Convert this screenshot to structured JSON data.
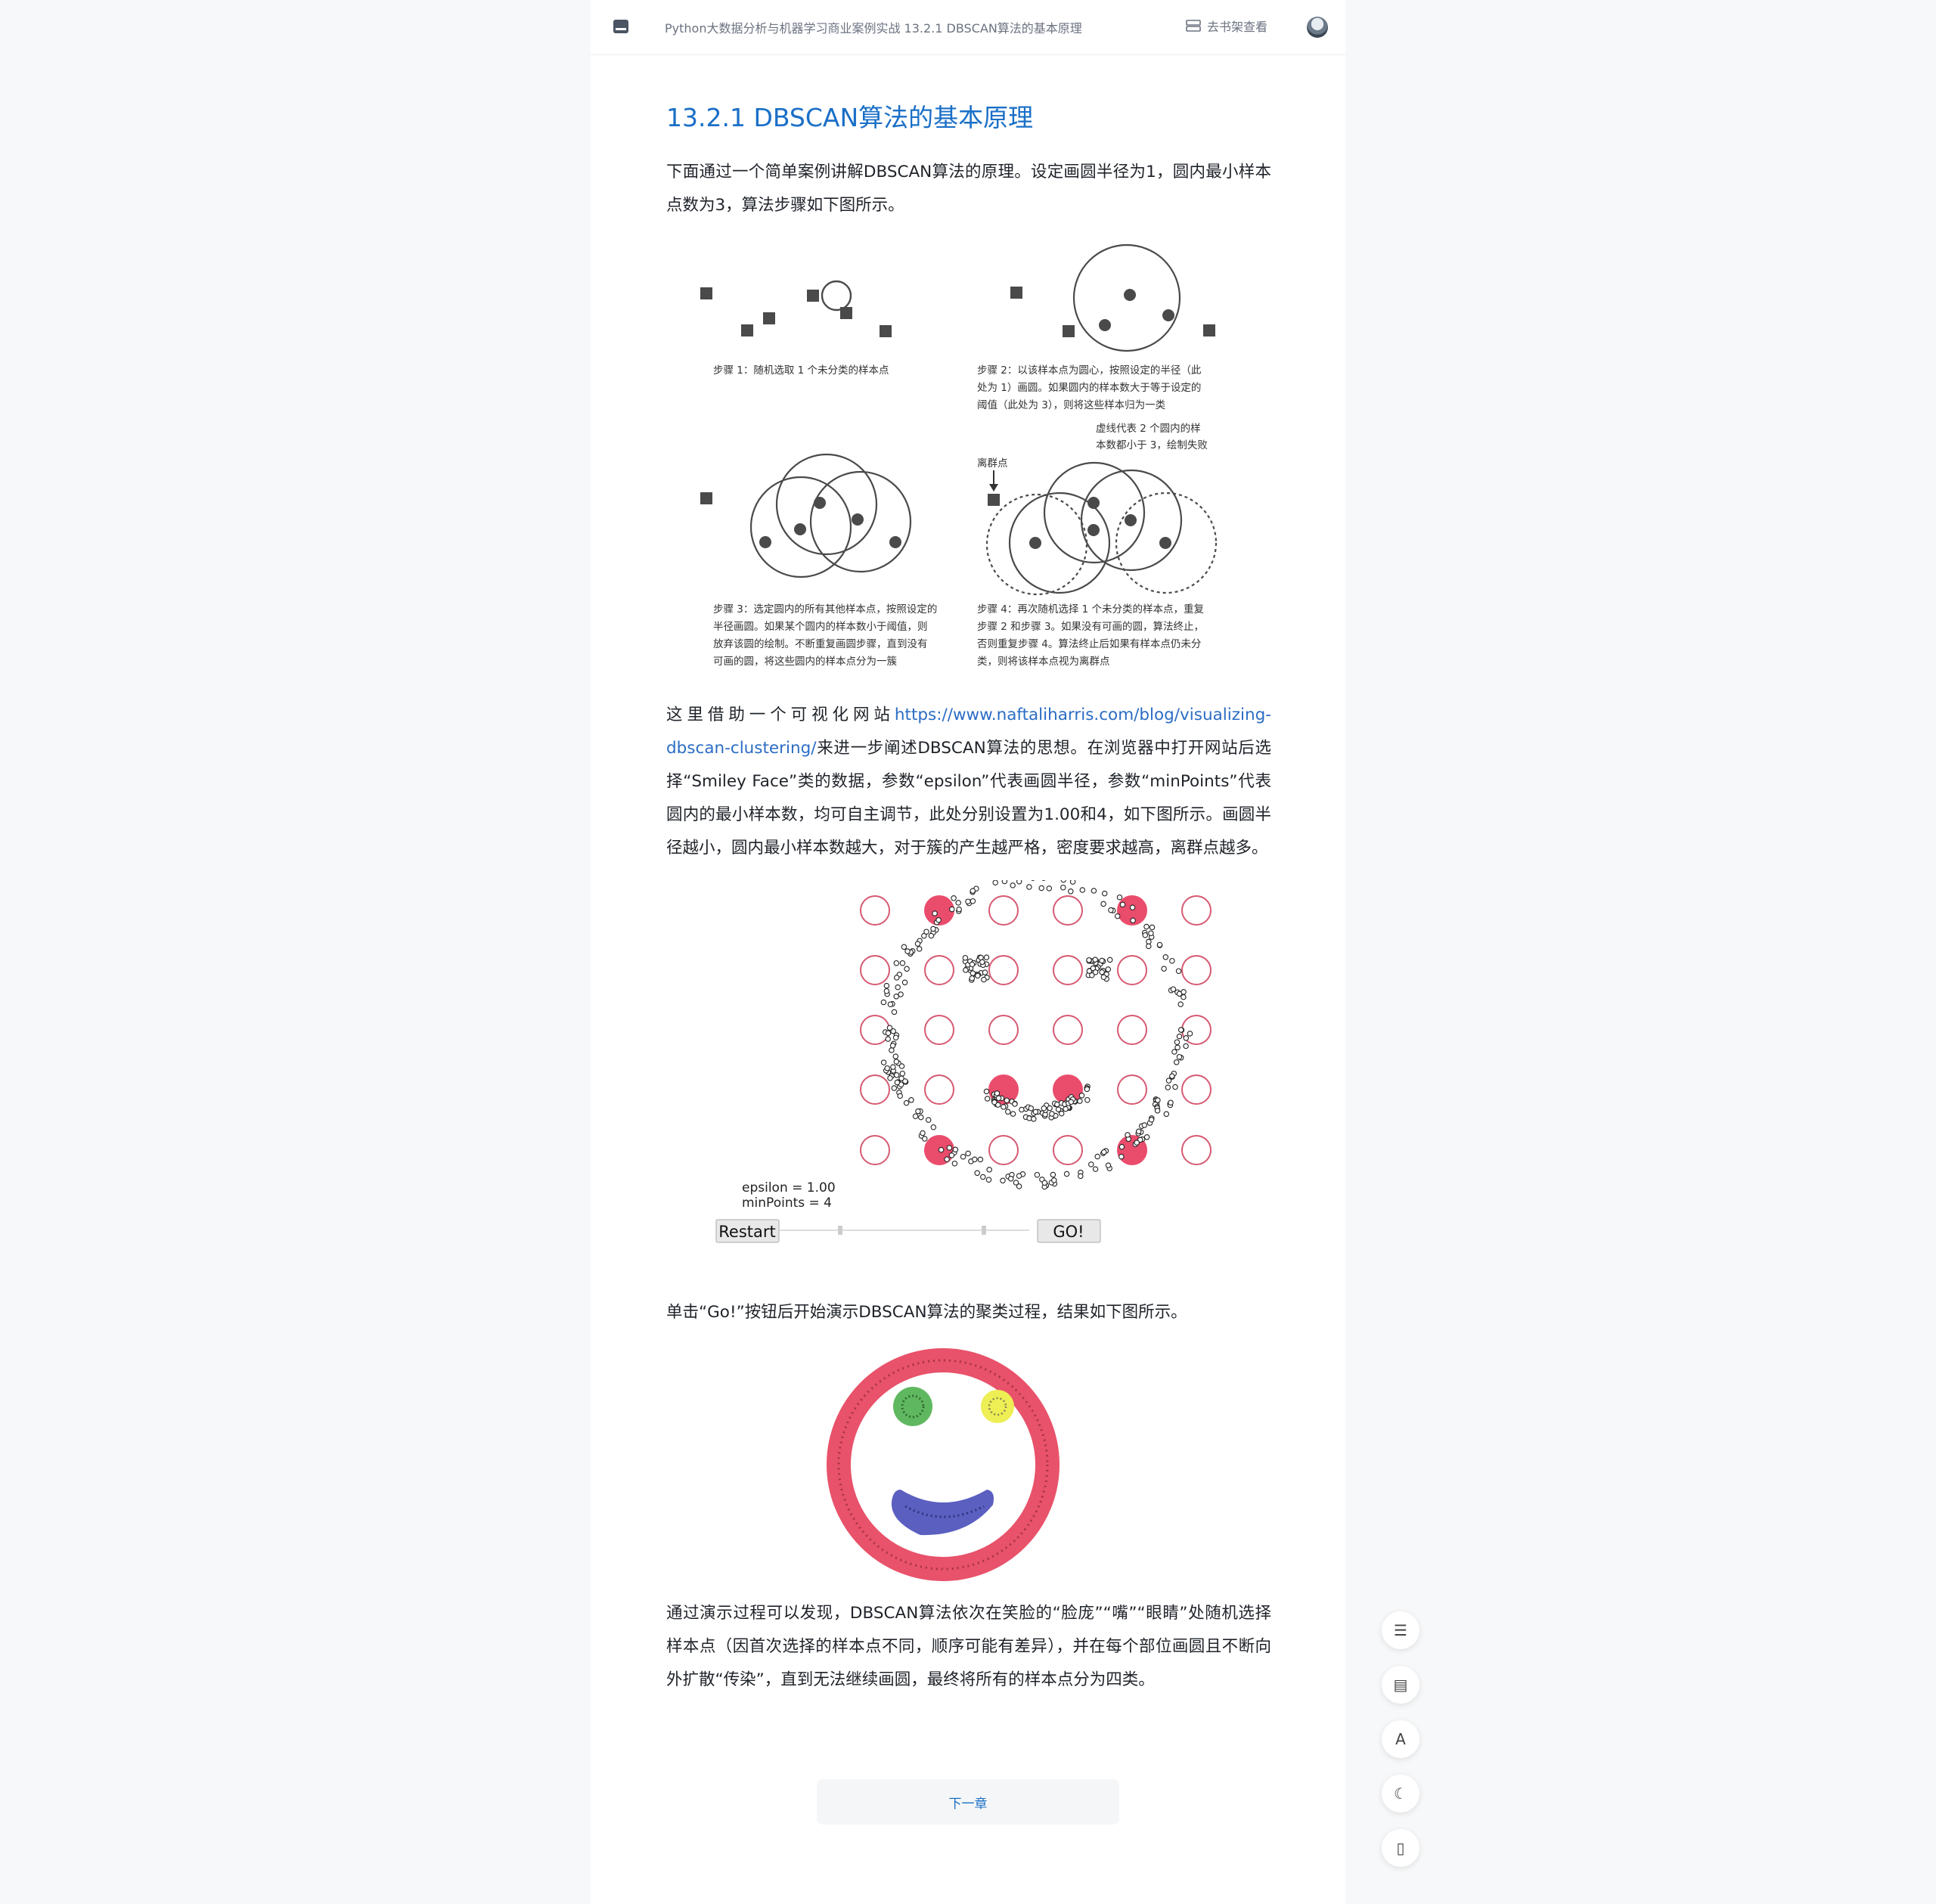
{
  "header": {
    "book_title": "Python大数据分析与机器学习商业案例实战 13.2.1 DBSCAN算法的基本原理",
    "shelf_label": "去书架查看"
  },
  "article": {
    "heading": "13.2.1 DBSCAN算法的基本原理",
    "para1": "下面通过一个简单案例讲解DBSCAN算法的原理。设定画圆半径为1，圆内最小样本点数为3，算法步骤如下图所示。",
    "para2_prefix": "这里借助一个可视化网站",
    "para2_link": "https://www.naftaliharris.com/blog/visualizing-dbscan-clustering/",
    "para2_suffix": "来进一步阐述DBSCAN算法的思想。在浏览器中打开网站后选择“Smiley Face”类的数据，参数“epsilon”代表画圆半径，参数“minPoints”代表圆内的最小样本数，均可自主调节，此处分别设置为1.00和4，如下图所示。画圆半径越小，圆内最小样本数越大，对于簇的产生越严格，密度要求越高，离群点越多。",
    "para3": "单击“Go!”按钮后开始演示DBSCAN算法的聚类过程，结果如下图所示。",
    "para4": "通过演示过程可以发现，DBSCAN算法依次在笑脸的“脸庞”“嘴”“眼睛”处随机选择样本点（因首次选择的样本点不同，顺序可能有差异），并在每个部位画圆且不断向外扩散“传染”，直到无法继续画圆，最终将所有的样本点分为四类。"
  },
  "steps_figure": {
    "step1": "步骤 1：随机选取 1 个未分类的样本点",
    "step2_lines": [
      "步骤 2：以该样本点为圆心，按照设定的半径（此",
      "处为 1）画圆。如果圆内的样本数大于等于设定的",
      "阈值（此处为 3），则将这些样本归为一类"
    ],
    "step3_lines": [
      "步骤 3：选定圆内的所有其他样本点，按照设定的",
      "半径画圆。如果某个圆内的样本数小于阈值，则",
      "放弃该圆的绘制。不断重复画圆步骤，直到没有",
      "可画的圆，将这些圆内的样本点分为一簇"
    ],
    "step4_lines": [
      "步骤 4：再次随机选择 1 个未分类的样本点，重复",
      "步骤 2 和步骤 3。如果没有可画的圆，算法终止，",
      "否则重复步骤 4。算法终止后如果有样本点仍未分",
      "类，则将该样本点视为离群点"
    ],
    "dashed_note_lines": [
      "虚线代表 2 个圆内的样",
      "本数都小于 3，绘制失败"
    ],
    "outlier_label": "离群点"
  },
  "smiley_demo": {
    "epsilon_label": "epsilon = 1.00",
    "minpoints_label": "minPoints = 4",
    "restart_label": "Restart",
    "go_label": "GO!"
  },
  "side_tools": {
    "toc_glyph": "☰",
    "comment_glyph": "▤",
    "font_glyph": "A",
    "night_glyph": "☾",
    "mobile_glyph": "▯"
  },
  "next_chapter_label": "下一章",
  "colors": {
    "heading": "#1a6fc7",
    "cluster_face": "#e8526a",
    "cluster_eye_left": "#5fb85f",
    "cluster_eye_right": "#eeee55",
    "cluster_mouth": "#5a5fc0"
  }
}
